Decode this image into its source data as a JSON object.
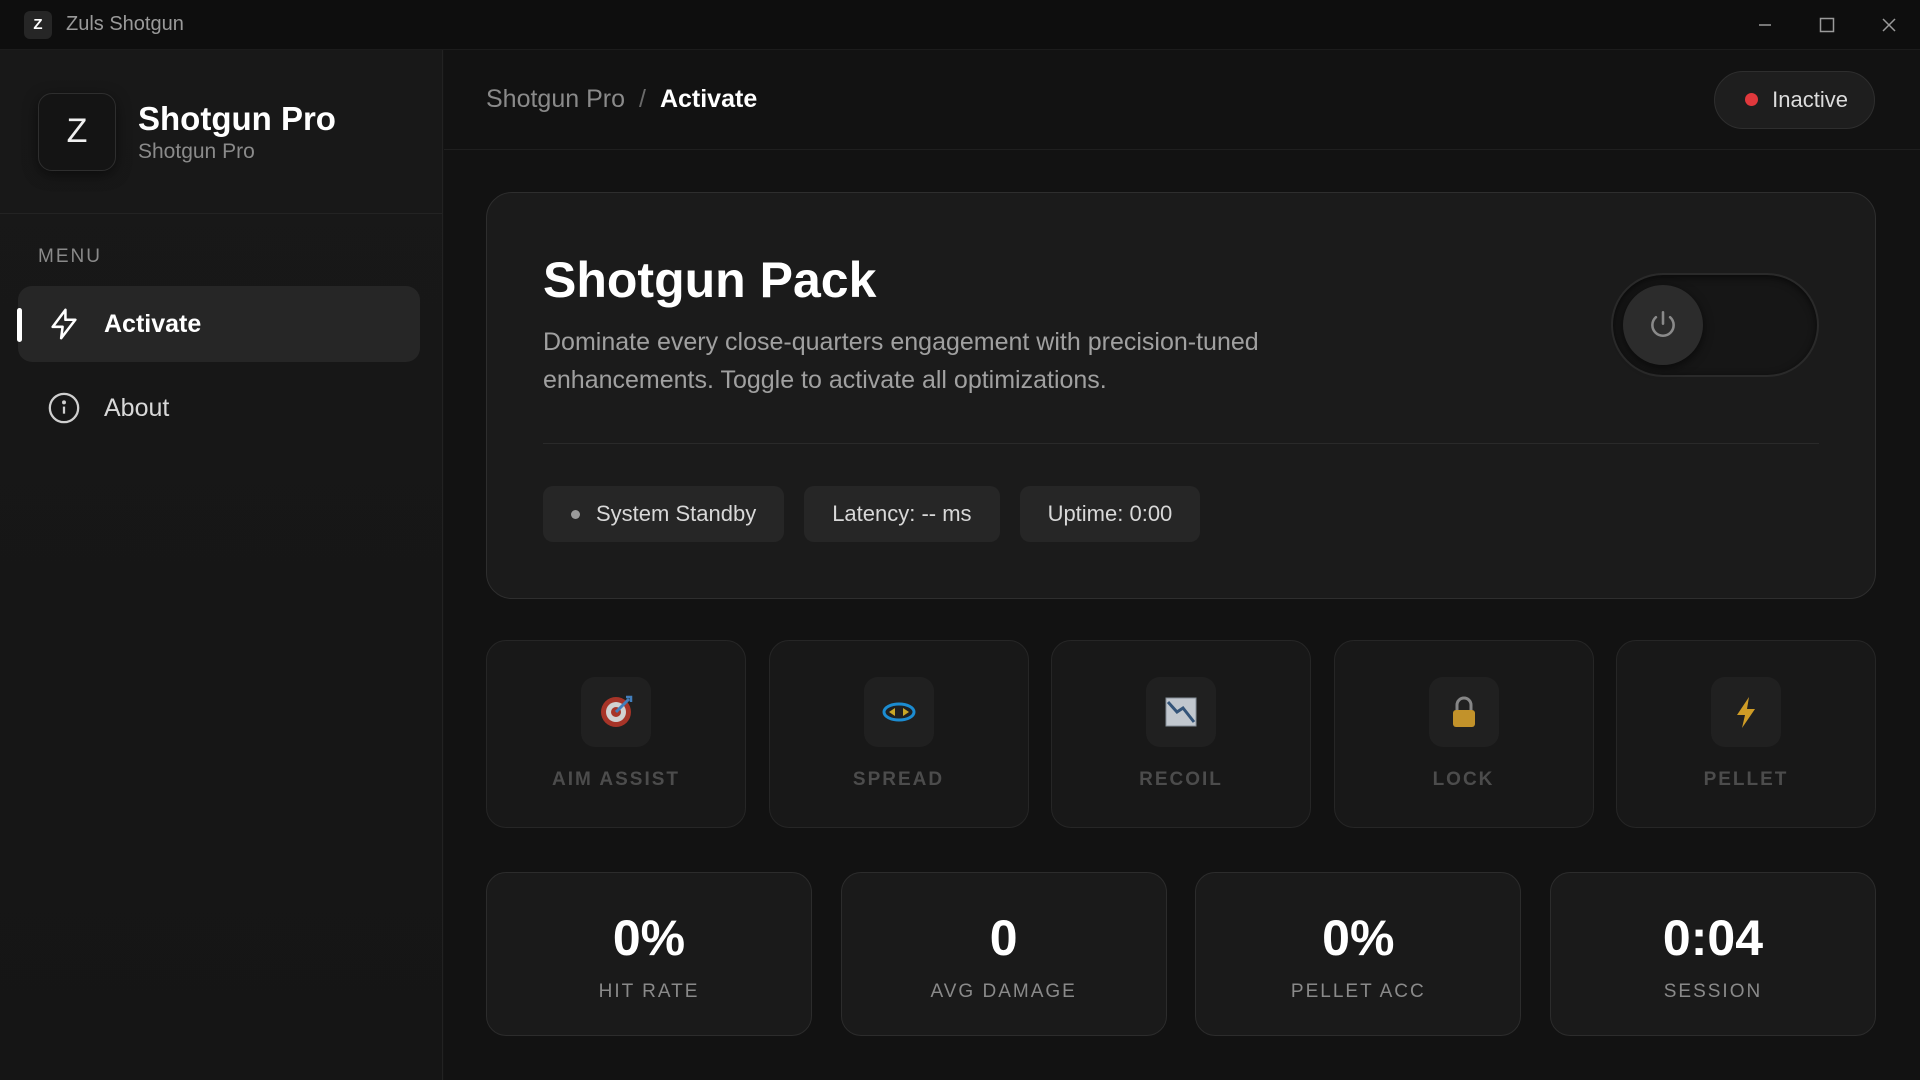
{
  "window": {
    "app_icon_letter": "Z",
    "title": "Zuls Shotgun",
    "controls": [
      "minimize-icon",
      "maximize-icon",
      "close-icon"
    ]
  },
  "sidebar": {
    "brand": {
      "logo_letter": "Z",
      "name": "Shotgun Pro",
      "subtitle": "Shotgun Pro"
    },
    "menu_heading": "MENU",
    "items": [
      {
        "label": "Activate",
        "icon": "lightning-icon",
        "active": true
      },
      {
        "label": "About",
        "icon": "info-icon",
        "active": false
      }
    ]
  },
  "header": {
    "breadcrumb": [
      {
        "label": "Shotgun Pro"
      },
      {
        "label": "Activate"
      }
    ],
    "separator": "/",
    "status": {
      "label": "Inactive",
      "color": "#e0383c"
    }
  },
  "hero": {
    "title": "Shotgun Pack",
    "description": "Dominate every close-quarters engagement with precision-tuned enhancements. Toggle to activate all optimizations.",
    "toggle_on": false,
    "chips": [
      {
        "label": "System Standby",
        "icon": "status-dot"
      },
      {
        "label": "Latency: -- ms"
      },
      {
        "label": "Uptime: 0:00"
      }
    ]
  },
  "features": [
    {
      "label": "AIM ASSIST",
      "icon": "target-icon"
    },
    {
      "label": "SPREAD",
      "icon": "spread-icon"
    },
    {
      "label": "RECOIL",
      "icon": "recoil-icon"
    },
    {
      "label": "LOCK",
      "icon": "lock-icon"
    },
    {
      "label": "PELLET",
      "icon": "lightning-icon"
    }
  ],
  "stats": [
    {
      "value": "0%",
      "label": "HIT RATE"
    },
    {
      "value": "0",
      "label": "AVG DAMAGE"
    },
    {
      "value": "0%",
      "label": "PELLET ACC"
    },
    {
      "value": "0:04",
      "label": "SESSION"
    }
  ],
  "colors": {
    "accent_inactive": "#e0383c",
    "background": "#121212",
    "card": "#1b1b1b"
  }
}
